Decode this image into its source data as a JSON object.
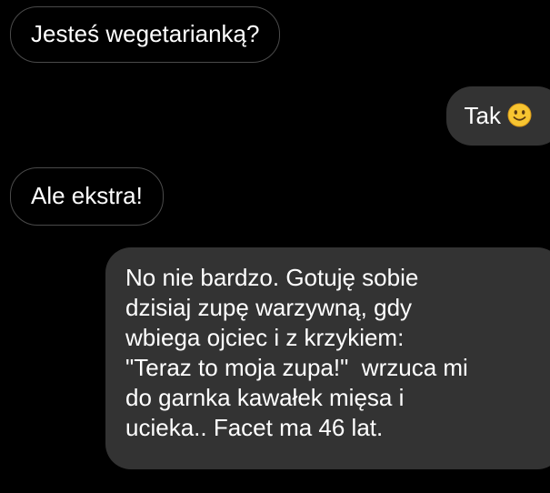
{
  "conversation": {
    "messages": [
      {
        "direction": "incoming",
        "text": "Jesteś wegetarianką?"
      },
      {
        "direction": "outgoing",
        "text": "Tak",
        "emoji": "slightly-smiling-face-icon"
      },
      {
        "direction": "incoming",
        "text": "Ale ekstra!"
      },
      {
        "direction": "outgoing",
        "lines": [
          "No nie bardzo. Gotuję sobie",
          "dzisiaj zupę warzywną, gdy",
          "wbiega ojciec i z krzykiem:",
          "\"Teraz to moja zupa!\"  wrzuca mi",
          "do garnka kawałek mięsa i",
          "ucieka.. Facet ma 46 lat."
        ]
      }
    ]
  },
  "colors": {
    "background": "#000000",
    "incoming_border": "#4a4a4a",
    "outgoing_bubble": "#333333",
    "text": "#ffffff",
    "emoji_face": "#f7c531"
  }
}
